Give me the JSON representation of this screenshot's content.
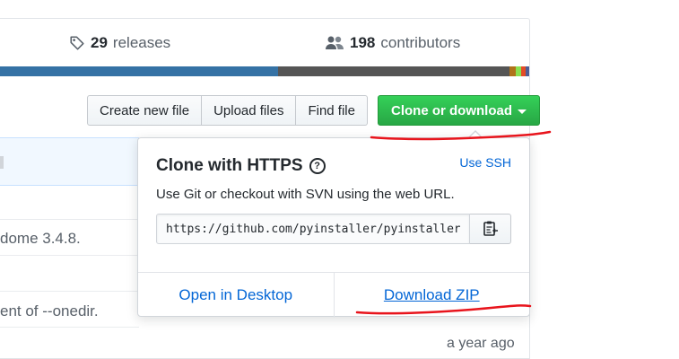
{
  "stats": {
    "releases_count": "29",
    "releases_label": "releases",
    "contributors_count": "198",
    "contributors_label": "contributors"
  },
  "language_bar": [
    {
      "color": "#3572A5",
      "share": 0.525
    },
    {
      "color": "#555555",
      "share": 0.438
    },
    {
      "color": "#b07219",
      "share": 0.012
    },
    {
      "color": "#89e051",
      "share": 0.01
    },
    {
      "color": "#e34c26",
      "share": 0.008
    },
    {
      "color": "#4F5D95",
      "share": 0.007
    }
  ],
  "toolbar": {
    "create_file": "Create new file",
    "upload_files": "Upload files",
    "find_file": "Find file",
    "clone_download": "Clone or download"
  },
  "file_list": {
    "commit_1": "dome 3.4.8.",
    "commit_2": "ent of --onedir.",
    "age": "a year ago"
  },
  "clone_dropdown": {
    "title": "Clone with HTTPS",
    "help_glyph": "?",
    "use_ssh": "Use SSH",
    "description": "Use Git or checkout with SVN using the web URL.",
    "url": "https://github.com/pyinstaller/pyinstaller.git",
    "open_desktop": "Open in Desktop",
    "download_zip": "Download ZIP"
  },
  "colors": {
    "accent_green": "#28a745",
    "link_blue": "#0366d6",
    "annotation_red": "#e8141c"
  },
  "icons": {
    "releases": "tag-icon",
    "contributors": "people-icon",
    "copy": "clipboard-icon",
    "help": "question-circle-icon"
  }
}
